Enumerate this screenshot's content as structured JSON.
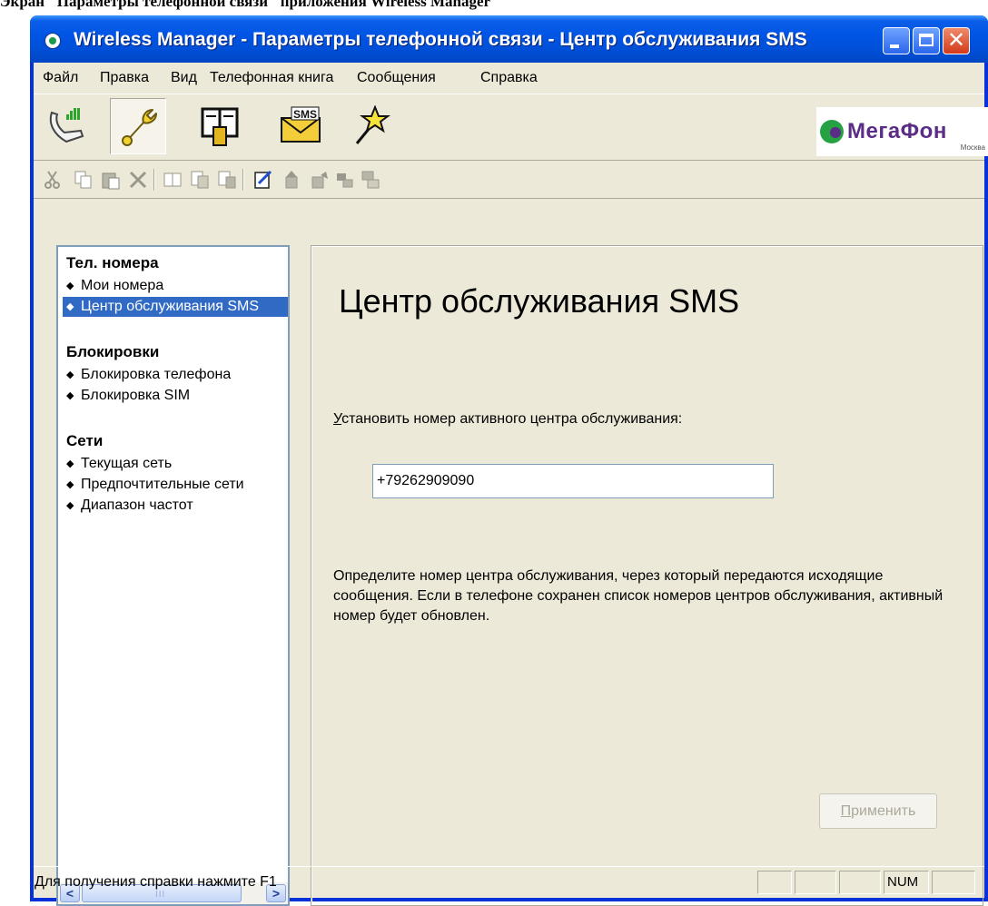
{
  "caption": "Экран \"Параметры телефонной связи\" приложения Wireless Manager",
  "window": {
    "title": "Wireless Manager - Параметры телефонной связи - Центр обслуживания SMS"
  },
  "menu": [
    "Файл",
    "Правка",
    "Вид",
    "Телефонная книга",
    "Сообщения",
    "Справка"
  ],
  "big_toolbar": {
    "buttons": [
      "connection-icon",
      "settings-wrench-icon",
      "phonebook-icon",
      "sms-envelope-icon",
      "wizard-wand-icon"
    ],
    "sms_icon_text": "SMS",
    "logo": {
      "name": "МегаФон",
      "city": "Москва"
    }
  },
  "nav": {
    "groups": [
      {
        "title": "Тел. номера",
        "items": [
          "Мои номера",
          "Центр обслуживания SMS"
        ]
      },
      {
        "title": "Блокировки",
        "items": [
          "Блокировка телефона",
          "Блокировка SIM"
        ]
      },
      {
        "title": "Сети",
        "items": [
          "Текущая сеть",
          "Предпочтительные сети",
          "Диапазон частот"
        ]
      }
    ],
    "selected": "Центр обслуживания SMS",
    "scroll_left": "<",
    "scroll_right": ">",
    "scroll_grip": "III"
  },
  "content": {
    "title": "Центр обслуживания SMS",
    "field_label_hotkey": "У",
    "field_label_rest": "становить номер активного центра обслуживания:",
    "sms_center_number": "+79262909090",
    "description": "Определите номер центра обслуживания, через который передаются исходящие сообщения. Если в телефоне сохранен список номеров центров обслуживания, активный номер будет обновлен.",
    "apply_hotkey": "П",
    "apply_rest": "рименить"
  },
  "statusbar": {
    "help_text": "Для получения справки нажмите F1",
    "num": "NUM"
  },
  "colors": {
    "titlebar": "#0055e5",
    "selection": "#316ac5",
    "logo_purple": "#5b2d86",
    "logo_green": "#26a143"
  }
}
